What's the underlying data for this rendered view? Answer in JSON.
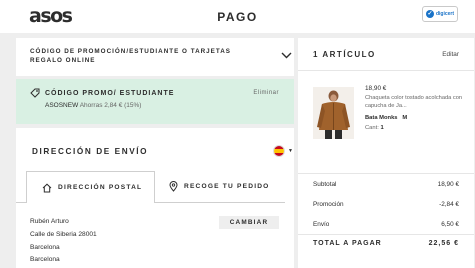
{
  "header": {
    "logo": "asos",
    "title": "PAGO",
    "badge_text": "digicert"
  },
  "promo": {
    "question": "CÓDIGO DE PROMOCIÓN/ESTUDIANTE O TARJETAS REGALO ONLINE",
    "applied_title": "CÓDIGO PROMO/ ESTUDIANTE",
    "code": "ASOSNEW",
    "saving_text": "Ahorras 2,84 € (15%)",
    "remove_label": "Eliminar"
  },
  "shipping": {
    "title": "DIRECCIÓN DE ENVÍO",
    "tabs": [
      {
        "label": "DIRECCIÓN POSTAL"
      },
      {
        "label": "RECOGE TU PEDIDO"
      }
    ],
    "address": [
      "Rubén Arturo",
      "Calle de Siberia 28001",
      "Barcelona",
      "Barcelona"
    ],
    "change_label": "CAMBIAR"
  },
  "summary": {
    "count_label": "1 ARTÍCULO",
    "edit_label": "Editar",
    "item": {
      "price": "18,90 €",
      "description": "Chaqueta color tostado acolchada con capucha de Ja...",
      "brand": "Bata Monks",
      "size": "M",
      "qty_label": "Cant:",
      "qty": "1"
    },
    "rows": [
      {
        "label": "Subtotal",
        "value": "18,90 €"
      },
      {
        "label": "Promoción",
        "value": "-2,84 €"
      },
      {
        "label": "Envío",
        "value": "6,50 €"
      }
    ],
    "total": {
      "label": "TOTAL A PAGAR",
      "value": "22,56 €"
    }
  },
  "colors": {
    "promo_bg": "#d9f0e3",
    "page_bg": "#eeeeee",
    "text": "#2d2d2d"
  }
}
